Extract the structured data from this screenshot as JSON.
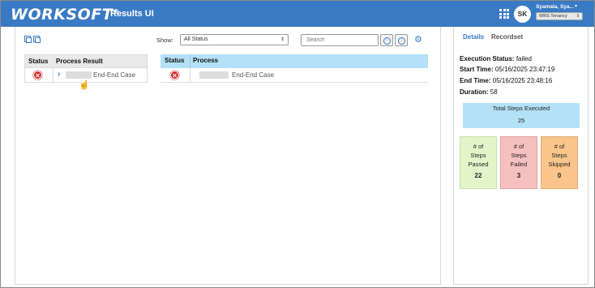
{
  "header": {
    "logo": "WORKSOFT",
    "logo_mark": "®",
    "app_title": "Results UI",
    "avatar_initials": "SK",
    "user_name": "Syamala, Sya...",
    "tenancy": "WRS Tenancy"
  },
  "toolbar": {
    "show_label": "Show:",
    "status_filter": "All Status",
    "search_placeholder": "Search"
  },
  "left_table": {
    "columns": [
      "Status",
      "Process Result"
    ],
    "rows": [
      {
        "status": "failed",
        "name": "End-End Case"
      }
    ]
  },
  "right_table": {
    "columns": [
      "Status",
      "Process"
    ],
    "rows": [
      {
        "status": "failed",
        "name": "End-End Case"
      }
    ]
  },
  "side": {
    "tabs": [
      "Details",
      "Recordset"
    ],
    "execution_status_label": "Execution Status:",
    "execution_status": "failed",
    "start_time_label": "Start Time:",
    "start_time": "05/16/2025 23:47:19",
    "end_time_label": "End Time:",
    "end_time": "05/16/2025 23:48:16",
    "duration_label": "Duration:",
    "duration": "58",
    "total_label": "Total Steps Executed",
    "total_value": "25",
    "passed": {
      "l1": "# of",
      "l2": "Steps",
      "l3": "Passed",
      "value": "22"
    },
    "failed": {
      "l1": "# of",
      "l2": "Steps",
      "l3": "Failed",
      "value": "3"
    },
    "skipped": {
      "l1": "# of",
      "l2": "Steps",
      "l3": "Skipped",
      "value": "0"
    }
  },
  "colors": {
    "header": "#3a7ac4",
    "table_header_right": "#b3e1f7",
    "passed": "#e1f5c8",
    "failed": "#f7c0c0",
    "skipped": "#f9c58a",
    "fail_icon": "#d32f2f"
  },
  "icons": [
    "apps-grid-icon",
    "copy-icon",
    "expand-icon",
    "collapse-icon",
    "settings-gear-icon",
    "status-failed-icon",
    "chevron-right-icon",
    "pointer-cursor-icon"
  ]
}
